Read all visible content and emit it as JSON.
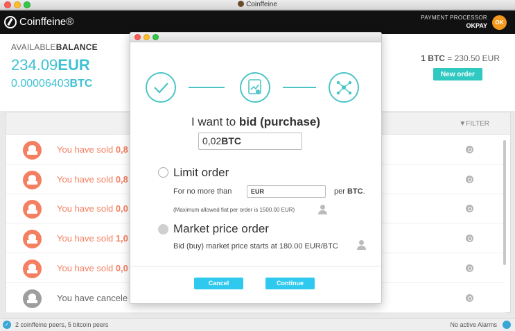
{
  "window": {
    "title": "Coinffeine"
  },
  "header": {
    "brand": "Coinffeine®",
    "payment_processor_label": "PAYMENT PROCESSOR",
    "payment_processor_name": "OKPAY",
    "payment_badge": "OK"
  },
  "balance": {
    "label_prefix": "AVAILABLE",
    "label_bold": "BALANCE",
    "eur_value": "234.09",
    "eur_unit": "EUR",
    "btc_value": "0.00006403",
    "btc_unit": "BTC",
    "rate_left": "1 BTC",
    "rate_right": "= 230.50 EUR",
    "new_order_label": "New order"
  },
  "list": {
    "filter_label": "FILTER",
    "rows": [
      {
        "prefix": "You have sold ",
        "bold": "0,8",
        "kind": "sold"
      },
      {
        "prefix": "You have sold ",
        "bold": "0,8",
        "kind": "sold"
      },
      {
        "prefix": "You have sold ",
        "bold": "0,0",
        "kind": "sold"
      },
      {
        "prefix": "You have sold ",
        "bold": "1,0",
        "kind": "sold"
      },
      {
        "prefix": "You have sold ",
        "bold": "0,0",
        "kind": "sold"
      },
      {
        "prefix": "You have cancele",
        "bold": "",
        "kind": "cancelled"
      }
    ]
  },
  "status": {
    "peers": "2 coinffeine peers, 5 bitcoin peers",
    "alarms": "No active Alarms"
  },
  "modal": {
    "want_prefix": "I want to ",
    "want_bold": "bid (purchase)",
    "amount_value": "0,02",
    "amount_unit": "BTC",
    "limit_label": "Limit order",
    "limit_prefix": "For no more than",
    "limit_currency": "EUR",
    "limit_per": "per ",
    "limit_per_unit": "BTC",
    "limit_per_suffix": ".",
    "max_note": "(Maximum allowed fiat per order is 1500.00 EUR)",
    "market_label": "Market price order",
    "market_note": "Bid (buy) market price starts at 180.00 EUR/BTC",
    "cancel_label": "Cancel",
    "continue_label": "Continue"
  },
  "colors": {
    "accent": "#3ec1d3",
    "button": "#2fc9ef",
    "sold": "#f47f61",
    "okpay": "#f39a1e"
  }
}
